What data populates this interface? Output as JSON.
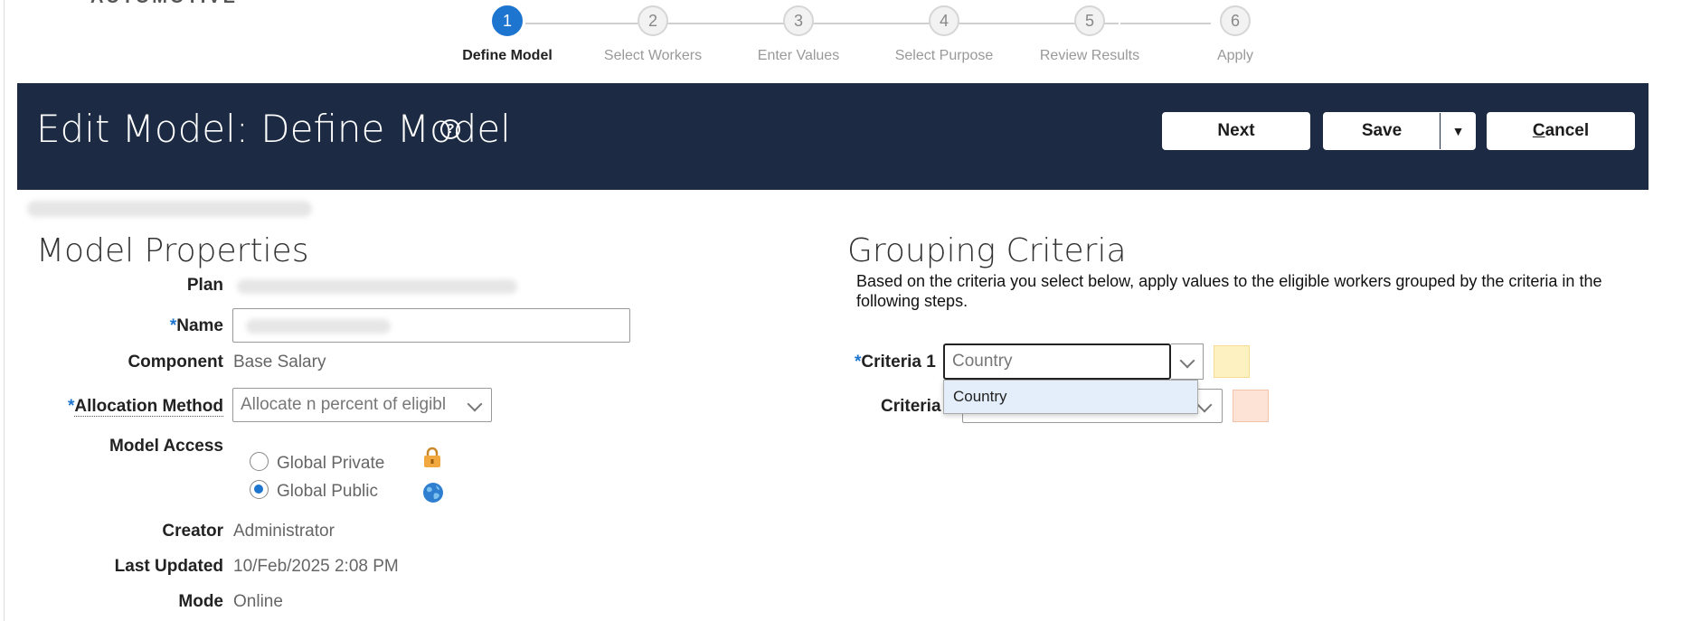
{
  "brand": {
    "logo_text": "AUTOMOTIVE"
  },
  "train": {
    "stops": [
      {
        "number": "1",
        "label": "Define Model",
        "active": true
      },
      {
        "number": "2",
        "label": "Select Workers",
        "active": false
      },
      {
        "number": "3",
        "label": "Enter Values",
        "active": false
      },
      {
        "number": "4",
        "label": "Select Purpose",
        "active": false
      },
      {
        "number": "5",
        "label": "Review Results",
        "active": false
      },
      {
        "number": "6",
        "label": "Apply",
        "active": false
      }
    ]
  },
  "header": {
    "title": "Edit Model: Define Model",
    "help_icon": "?",
    "next_label": "Next",
    "save_label": "Save",
    "save_menu_icon": "▼",
    "cancel_label": "Cancel"
  },
  "model_properties": {
    "title": "Model Properties",
    "plan_label": "Plan",
    "name_label": "Name",
    "required_mark": "*",
    "component_label": "Component",
    "component_value": "Base Salary",
    "allocation_label": "Allocation Method",
    "allocation_value": "Allocate n percent of eligibl",
    "access_label": "Model Access",
    "access_options": [
      {
        "label": "Global Private",
        "selected": false,
        "icon": "lock-icon"
      },
      {
        "label": "Global Public",
        "selected": true,
        "icon": "globe-icon"
      }
    ],
    "creator_label": "Creator",
    "creator_value": "Administrator",
    "updated_label": "Last Updated",
    "updated_value": "10/Feb/2025 2:08 PM",
    "mode_label": "Mode",
    "mode_value": "Online"
  },
  "grouping": {
    "title": "Grouping Criteria",
    "description": "Based on the criteria you select below, apply values to the eligible workers grouped by the criteria in the following steps.",
    "criteria1_label": "Criteria 1",
    "criteria1_value": "Country",
    "criteria2_label": "Criteria",
    "dropdown_option": "Country",
    "swatch1_color": "#fdf1c2",
    "swatch2_color": "#fde3d6"
  }
}
